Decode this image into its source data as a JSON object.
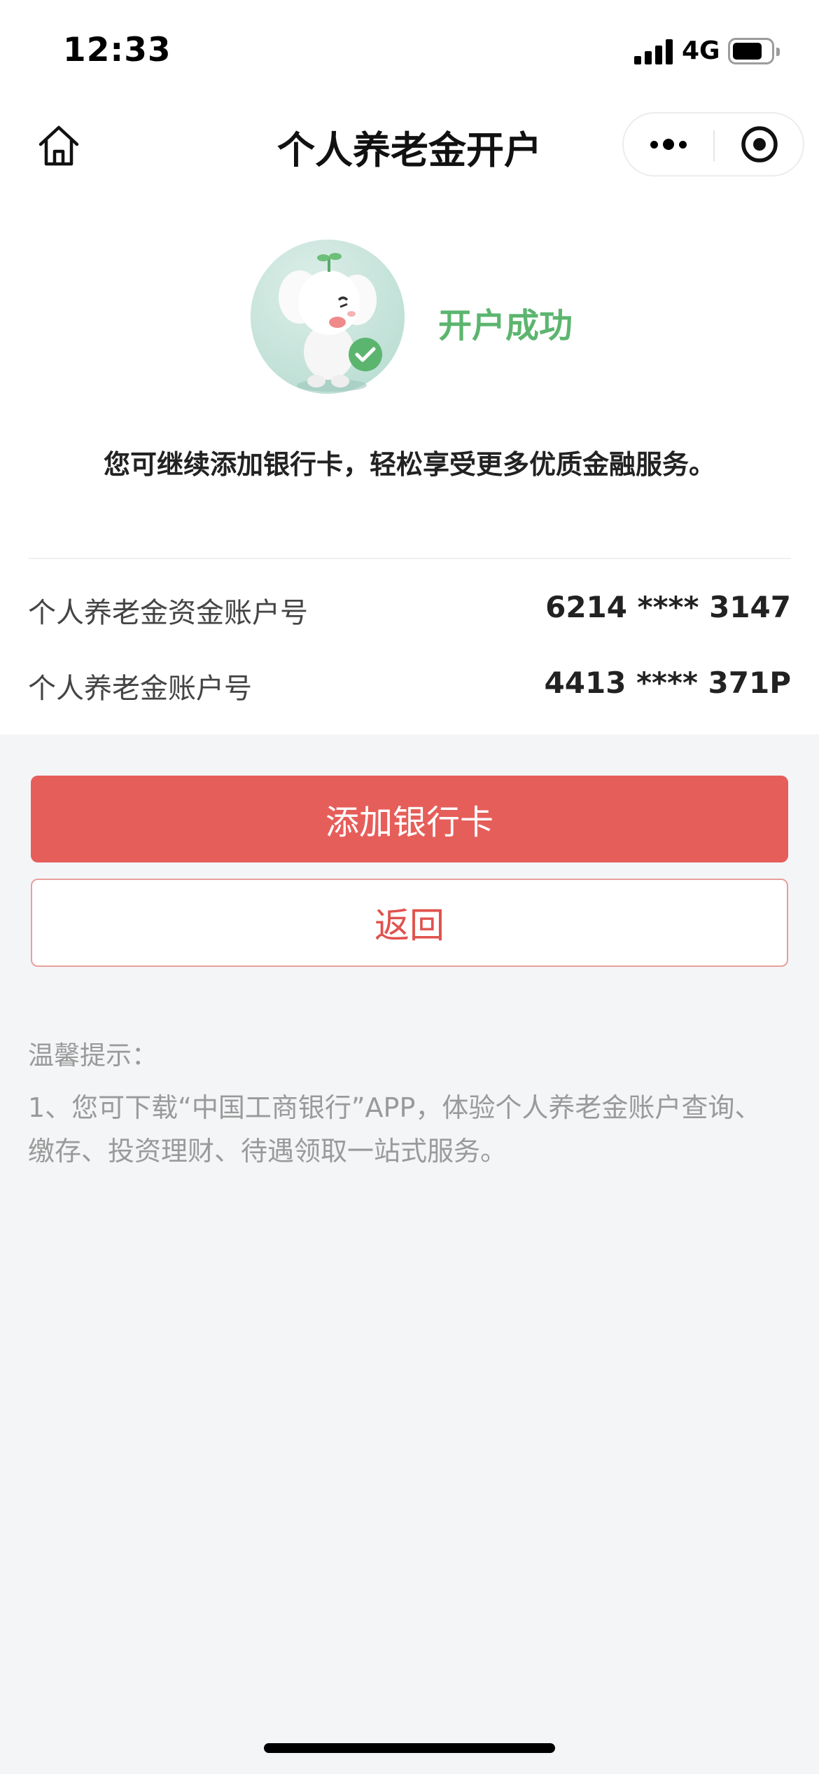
{
  "status_bar": {
    "time": "12:33",
    "network": "4G",
    "battery_level": 0.75
  },
  "nav": {
    "title": "个人养老金开户",
    "home_icon": "home-icon",
    "more_icon": "more-dots-icon",
    "close_icon": "target-circle-icon"
  },
  "result": {
    "status_text": "开户成功",
    "description": "您可继续添加银行卡，轻松享受更多优质金融服务。",
    "accent_color": "#5cb56f"
  },
  "accounts": [
    {
      "label": "个人养老金资金账户号",
      "value": "6214 **** 3147"
    },
    {
      "label": "个人养老金账户号",
      "value": "4413 **** 371P"
    }
  ],
  "actions": {
    "primary_label": "添加银行卡",
    "secondary_label": "返回",
    "primary_color": "#e65e5a"
  },
  "tips": {
    "title": "温馨提示：",
    "line1": "1、您可下载“中国工商银行”APP，体验个人养老金账户查询、缴存、投资理财、待遇领取一站式服务。"
  }
}
